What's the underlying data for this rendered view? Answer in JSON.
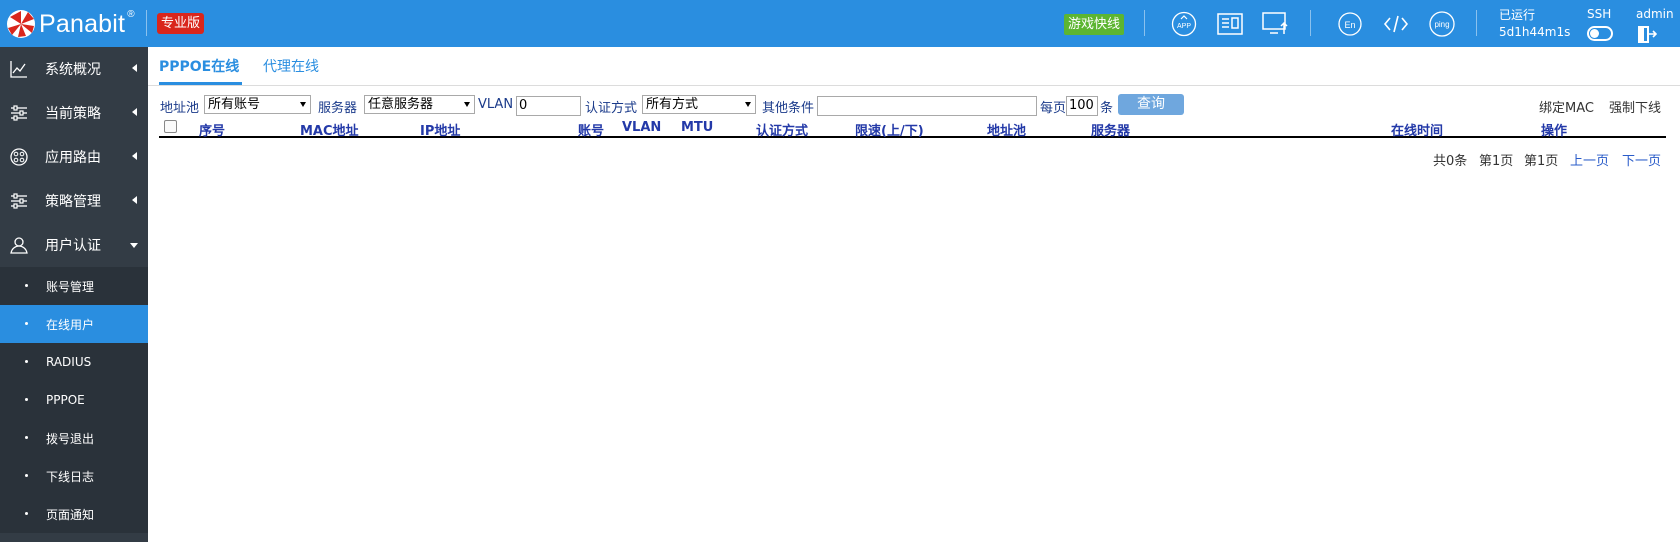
{
  "header": {
    "brand": "Panabit",
    "brand_reg": "®",
    "edition": "专业版",
    "fast_game": "游戏快线",
    "icons": [
      "app-icon",
      "news-icon",
      "monitor-upload-icon",
      "en-language-icon",
      "code-icon",
      "ping-icon"
    ],
    "ping_label": "ping",
    "en_label": "En",
    "uptime_label": "已运行",
    "uptime_value": "5d1h44m1s",
    "ssh_label": "SSH",
    "user": "admin"
  },
  "sidebar": {
    "items": [
      {
        "label": "系统概况",
        "icon": "chart-line-icon"
      },
      {
        "label": "当前策略",
        "icon": "sliders-icon"
      },
      {
        "label": "应用路由",
        "icon": "route-icon"
      },
      {
        "label": "策略管理",
        "icon": "sliders-icon"
      },
      {
        "label": "用户认证",
        "icon": "user-icon"
      }
    ],
    "subitems": [
      {
        "label": "账号管理"
      },
      {
        "label": "在线用户"
      },
      {
        "label": "RADIUS"
      },
      {
        "label": "PPPOE"
      },
      {
        "label": "拨号退出"
      },
      {
        "label": "下线日志"
      },
      {
        "label": "页面通知"
      }
    ]
  },
  "tabs": [
    {
      "label": "PPPOE在线"
    },
    {
      "label": "代理在线"
    }
  ],
  "filters": {
    "pool_label": "地址池",
    "pool_value": "所有账号",
    "server_label": "服务器",
    "server_value": "任意服务器",
    "vlan_label": "VLAN",
    "vlan_value": "0",
    "auth_label": "认证方式",
    "auth_value": "所有方式",
    "other_label": "其他条件",
    "other_value": "",
    "per_page_label": "每页",
    "per_page_value": "100",
    "per_page_unit": "条",
    "query_button": "查询",
    "bind_mac": "绑定MAC",
    "force_offline": "强制下线"
  },
  "table": {
    "columns": [
      "序号",
      "MAC地址",
      "IP地址",
      "账号",
      "VLAN",
      "MTU",
      "认证方式",
      "限速(上/下)",
      "地址池",
      "服务器",
      "在线时间",
      "操作"
    ],
    "rows": []
  },
  "pager": {
    "total": "共0条",
    "page1": "第1页",
    "page2": "第1页",
    "prev": "上一页",
    "next": "下一页"
  }
}
